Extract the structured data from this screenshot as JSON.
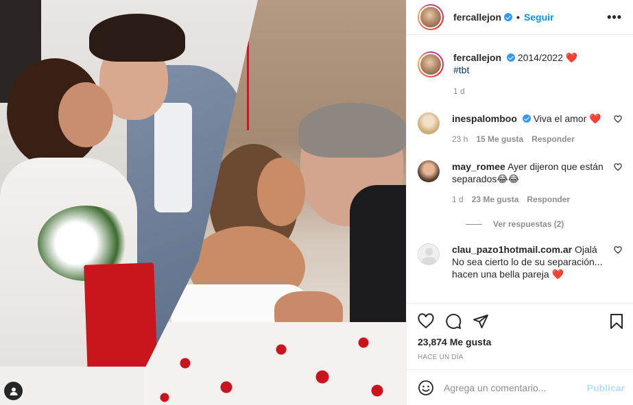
{
  "post": {
    "image_alt": "",
    "author": {
      "username": "fercallejon",
      "verified": true,
      "follow_label": "Seguir",
      "dot": "•"
    },
    "caption": {
      "username": "fercallejon",
      "text": "2014/2022",
      "emoji": "❤️",
      "hashtag": "#tbt",
      "time": "1 d"
    },
    "comments": [
      {
        "username": "inespalomboo",
        "verified": true,
        "text": "Viva el amor",
        "emoji": "❤️",
        "time": "23 h",
        "likes": "15 Me gusta",
        "reply": "Responder"
      },
      {
        "username": "may_romee",
        "verified": false,
        "text": "Ayer dijeron que están separados😂😂",
        "time": "1 d",
        "likes": "23 Me gusta",
        "reply": "Responder",
        "view_replies": "Ver respuestas (2)"
      },
      {
        "username": "clau_pazo1hotmail.com.ar",
        "verified": false,
        "text": "Ojalá No sea cierto lo de su separación... hacen una bella pareja ❤️"
      }
    ],
    "likes_count": "23,874 Me gusta",
    "date": "HACE UN DÍA",
    "comment_input": {
      "placeholder": "Agrega un comentario...",
      "publish_label": "Publicar"
    },
    "icons": {
      "like": "heart-outline-icon",
      "comment": "comment-bubble-icon",
      "share": "paper-plane-icon",
      "save": "bookmark-icon",
      "emoji": "smiley-icon",
      "more": "more-dots-icon",
      "tag": "user-tag-icon"
    },
    "colors": {
      "link_blue": "#0095f6",
      "verified_blue": "#3897f0",
      "heart_red": "#e0245e",
      "publish_disabled": "#b2dffc",
      "muted_gray": "#8e8e8e"
    }
  }
}
